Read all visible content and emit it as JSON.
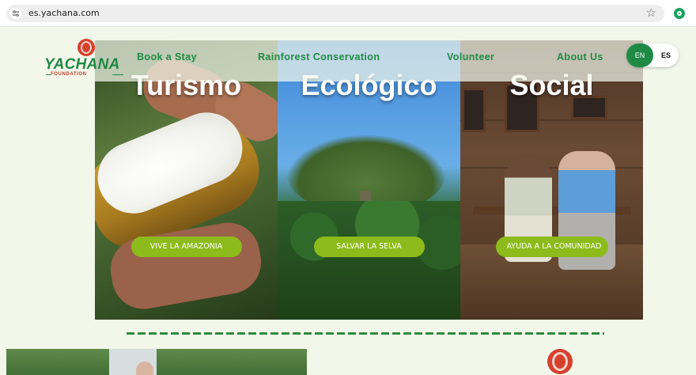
{
  "browser": {
    "url": "es.yachana.com",
    "site_info_icon": "tune-icon",
    "bookmark_icon": "star-icon",
    "extension_icon": "extension-icon"
  },
  "nav": {
    "logo_text": "YACHANA",
    "logo_subtext": "FOUNDATION",
    "links": [
      "Book a Stay",
      "Rainforest Conservation",
      "Volunteer",
      "About Us"
    ],
    "lang": {
      "en": "EN",
      "es": "ES",
      "active": "EN"
    }
  },
  "hero": {
    "panels": [
      {
        "title": "Turismo",
        "cta": "VIVE LA AMAZONIA"
      },
      {
        "title": "Ecológico",
        "cta": "SALVAR LA SELVA"
      },
      {
        "title": "Social",
        "cta": "AYUDA A LA COMUNIDAD"
      }
    ]
  },
  "colors": {
    "brand_green": "#1f8a45",
    "cta_green": "#8dbb1b",
    "brand_red": "#d6402e",
    "page_bg": "#f2f7ea"
  }
}
